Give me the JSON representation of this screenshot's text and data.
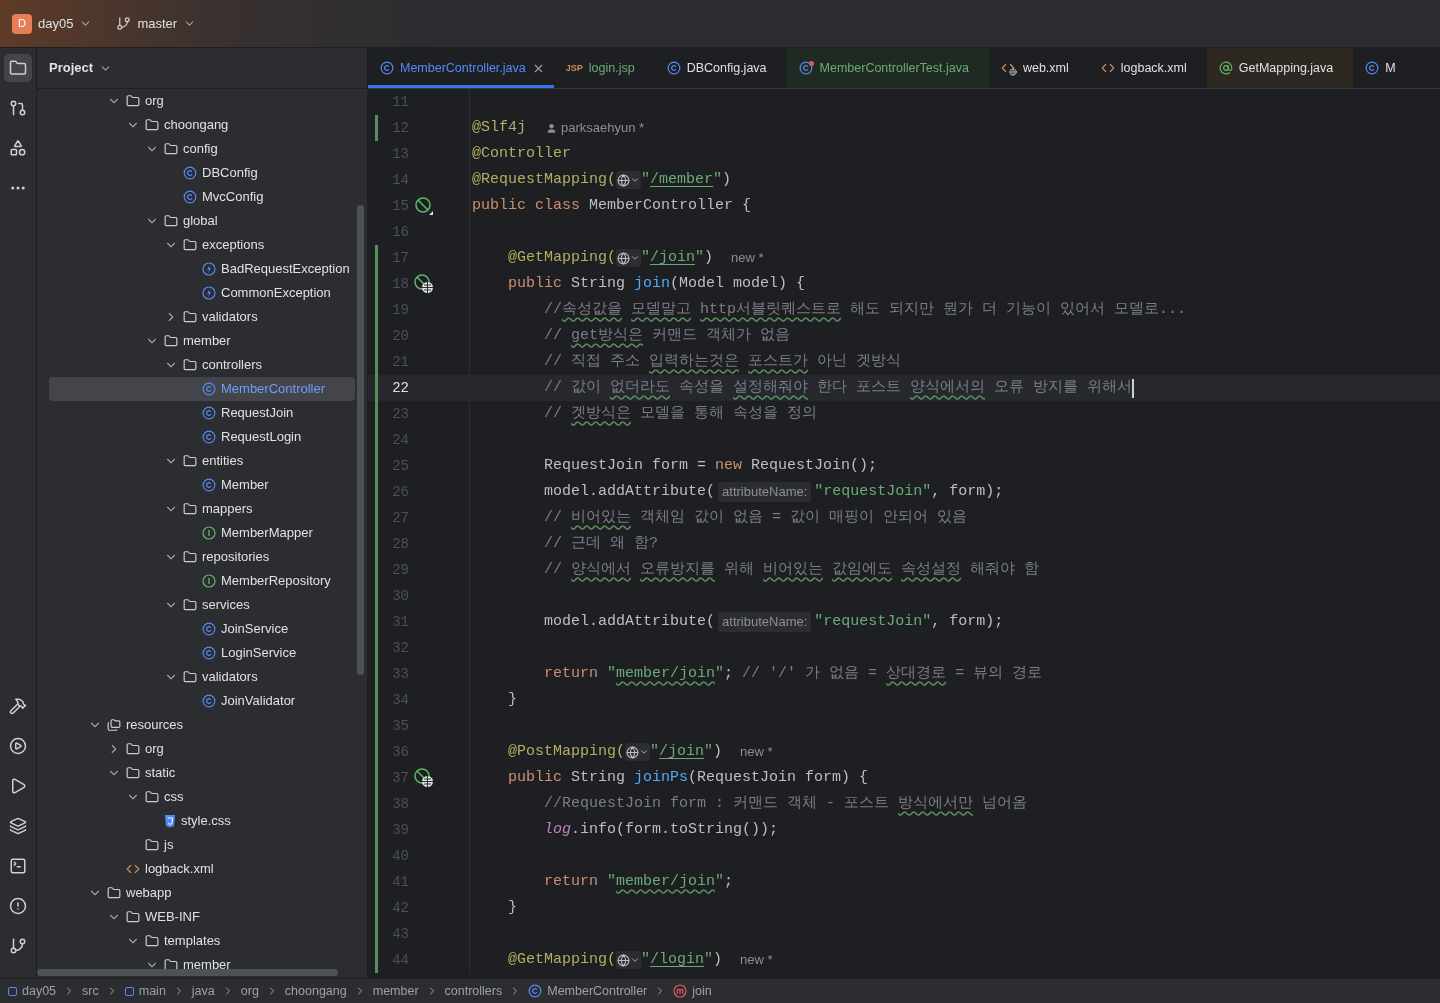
{
  "toolbar": {
    "project_badge": "D",
    "project": "day05",
    "branch": "master"
  },
  "project_panel": {
    "title": "Project",
    "tree": [
      {
        "kind": "offscreen",
        "children": [
          {
            "label": "org",
            "kind": "folder",
            "expanded": true,
            "selected": false,
            "children": [
              {
                "label": "choongang",
                "kind": "folder",
                "expanded": true,
                "selected": false,
                "children": [
                  {
                    "label": "config",
                    "kind": "folder",
                    "expanded": true,
                    "selected": false,
                    "children": [
                      {
                        "label": "DBConfig",
                        "kind": "class",
                        "selected": false
                      },
                      {
                        "label": "MvcConfig",
                        "kind": "class",
                        "selected": false
                      }
                    ]
                  },
                  {
                    "label": "global",
                    "kind": "folder",
                    "expanded": true,
                    "selected": false,
                    "children": [
                      {
                        "label": "exceptions",
                        "kind": "folder",
                        "expanded": true,
                        "selected": false,
                        "children": [
                          {
                            "label": "BadRequestException",
                            "kind": "exception",
                            "selected": false
                          },
                          {
                            "label": "CommonException",
                            "kind": "exception",
                            "selected": false
                          }
                        ]
                      },
                      {
                        "label": "validators",
                        "kind": "folder",
                        "expanded": false,
                        "selected": false
                      }
                    ]
                  },
                  {
                    "label": "member",
                    "kind": "folder",
                    "expanded": true,
                    "selected": false,
                    "children": [
                      {
                        "label": "controllers",
                        "kind": "folder",
                        "expanded": true,
                        "selected": false,
                        "children": [
                          {
                            "label": "MemberController",
                            "kind": "class",
                            "selected": true
                          },
                          {
                            "label": "RequestJoin",
                            "kind": "class",
                            "selected": false
                          },
                          {
                            "label": "RequestLogin",
                            "kind": "class",
                            "selected": false
                          }
                        ]
                      },
                      {
                        "label": "entities",
                        "kind": "folder",
                        "expanded": true,
                        "selected": false,
                        "children": [
                          {
                            "label": "Member",
                            "kind": "class",
                            "selected": false
                          }
                        ]
                      },
                      {
                        "label": "mappers",
                        "kind": "folder",
                        "expanded": true,
                        "selected": false,
                        "children": [
                          {
                            "label": "MemberMapper",
                            "kind": "interface",
                            "selected": false
                          }
                        ]
                      },
                      {
                        "label": "repositories",
                        "kind": "folder",
                        "expanded": true,
                        "selected": false,
                        "children": [
                          {
                            "label": "MemberRepository",
                            "kind": "interface",
                            "selected": false
                          }
                        ]
                      },
                      {
                        "label": "services",
                        "kind": "folder",
                        "expanded": true,
                        "selected": false,
                        "children": [
                          {
                            "label": "JoinService",
                            "kind": "class",
                            "selected": false
                          },
                          {
                            "label": "LoginService",
                            "kind": "class",
                            "selected": false
                          }
                        ]
                      },
                      {
                        "label": "validators",
                        "kind": "folder",
                        "expanded": true,
                        "selected": false,
                        "children": [
                          {
                            "label": "JoinValidator",
                            "kind": "class",
                            "selected": false
                          }
                        ]
                      }
                    ]
                  }
                ]
              }
            ]
          }
        ]
      },
      {
        "label": "resources",
        "kind": "resources",
        "expanded": true,
        "selected": false,
        "children": [
          {
            "label": "org",
            "kind": "folder",
            "expanded": false,
            "selected": false
          },
          {
            "label": "static",
            "kind": "folder",
            "expanded": true,
            "selected": false,
            "children": [
              {
                "label": "css",
                "kind": "folder",
                "expanded": true,
                "selected": false,
                "children": [
                  {
                    "label": "style.css",
                    "kind": "css",
                    "selected": false
                  }
                ]
              },
              {
                "label": "js",
                "kind": "folder",
                "selected": false
              }
            ]
          },
          {
            "label": "logback.xml",
            "kind": "xml",
            "selected": false
          }
        ]
      },
      {
        "label": "webapp",
        "kind": "folder",
        "expanded": true,
        "selected": false,
        "children": [
          {
            "label": "WEB-INF",
            "kind": "folder",
            "expanded": true,
            "selected": false,
            "children": [
              {
                "label": "templates",
                "kind": "folder",
                "expanded": true,
                "selected": false,
                "children": [
                  {
                    "label": "member",
                    "kind": "folder",
                    "expanded": true,
                    "selected": false
                  }
                ]
              }
            ]
          }
        ]
      }
    ]
  },
  "editor_tabs": [
    {
      "label": "MemberController.java",
      "kind": "class",
      "color": "#548af7",
      "selected": true,
      "closable": true,
      "test_scope": false,
      "library_scope": false
    },
    {
      "label": "login.jsp",
      "kind": "jsp",
      "icon_text": "JSP",
      "color": "#6aab73",
      "selected": false,
      "test_scope": false,
      "library_scope": false
    },
    {
      "label": "DBConfig.java",
      "kind": "class",
      "color": "#dfe1e5",
      "selected": false,
      "test_scope": false,
      "library_scope": false
    },
    {
      "label": "MemberControllerTest.java",
      "kind": "test",
      "color": "#6aab73",
      "selected": false,
      "test_scope": true,
      "library_scope": false
    },
    {
      "label": "web.xml",
      "kind": "webxml",
      "color": "#dfe1e5",
      "selected": false,
      "test_scope": false,
      "library_scope": false
    },
    {
      "label": "logback.xml",
      "kind": "xml",
      "color": "#dfe1e5",
      "selected": false,
      "test_scope": false,
      "library_scope": false
    },
    {
      "label": "GetMapping.java",
      "kind": "annotation",
      "color": "#dfe1e5",
      "selected": false,
      "test_scope": false,
      "library_scope": true
    },
    {
      "label": "M",
      "kind": "class",
      "color": "#dfe1e5",
      "selected": false,
      "test_scope": false,
      "library_scope": false
    }
  ],
  "editor": {
    "lines": [
      {
        "number": "11",
        "changed": false,
        "current": false
      },
      {
        "number": "12",
        "changed": true,
        "current": false,
        "tokens": [
          {
            "t": "@Slf4j",
            "kind": "ann"
          },
          {
            "t": "parksaehyun *",
            "kind": "author"
          }
        ]
      },
      {
        "number": "13",
        "changed": false,
        "current": false,
        "tokens": [
          {
            "t": "@Controller",
            "kind": "ann"
          }
        ]
      },
      {
        "number": "14",
        "changed": false,
        "current": false,
        "tokens": [
          {
            "t": "@RequestMapping(",
            "kind": "ann"
          },
          {
            "kind": "globe"
          },
          {
            "t": "\"",
            "kind": "str"
          },
          {
            "t": "/member",
            "kind": "url"
          },
          {
            "t": "\"",
            "kind": "str"
          },
          {
            "t": ")",
            "kind": "plain"
          }
        ]
      },
      {
        "number": "15",
        "changed": false,
        "current": false,
        "kind": "bean",
        "tokens": [
          {
            "t": "public class ",
            "kind": "kw"
          },
          {
            "t": "MemberController {",
            "kind": "plain"
          }
        ]
      },
      {
        "number": "16",
        "changed": false,
        "current": false
      },
      {
        "number": "17",
        "changed": true,
        "current": false,
        "tokens": [
          {
            "t": "    @GetMapping(",
            "kind": "ann"
          },
          {
            "kind": "globe"
          },
          {
            "t": "\"",
            "kind": "str"
          },
          {
            "t": "/join",
            "kind": "url"
          },
          {
            "t": "\"",
            "kind": "str"
          },
          {
            "t": ")",
            "kind": "plain"
          },
          {
            "t": "new *",
            "kind": "note"
          }
        ]
      },
      {
        "number": "18",
        "changed": true,
        "current": false,
        "kind": "endpoint",
        "tokens": [
          {
            "t": "    public ",
            "kind": "kw"
          },
          {
            "t": "String ",
            "kind": "plain"
          },
          {
            "t": "join",
            "kind": "fn"
          },
          {
            "t": "(Model model) {",
            "kind": "plain"
          }
        ]
      },
      {
        "number": "19",
        "changed": true,
        "current": false,
        "tokens": [
          {
            "t": "        //",
            "kind": "cmt"
          },
          {
            "t": "속성값을 ",
            "kind": "typo"
          },
          {
            "t": "모델말고 ",
            "kind": "typo"
          },
          {
            "t": "http서블릿퀘스트로",
            "kind": "typo"
          },
          {
            "t": " 해도 되지만 뭔가 더 기능이 있어서 모델로...",
            "kind": "cmt"
          }
        ]
      },
      {
        "number": "20",
        "changed": true,
        "current": false,
        "tokens": [
          {
            "t": "        // ",
            "kind": "cmt"
          },
          {
            "t": "get방식은",
            "kind": "typo"
          },
          {
            "t": " 커맨드 객체가 없음",
            "kind": "cmt"
          }
        ]
      },
      {
        "number": "21",
        "changed": true,
        "current": false,
        "tokens": [
          {
            "t": "        // 직접 주소 ",
            "kind": "cmt"
          },
          {
            "t": "입력하는것은 ",
            "kind": "typo"
          },
          {
            "t": "포스트가",
            "kind": "typo"
          },
          {
            "t": " 아닌 겟방식",
            "kind": "cmt"
          }
        ]
      },
      {
        "number": "22",
        "changed": true,
        "current": true,
        "tokens": [
          {
            "t": "        // 값이 ",
            "kind": "cmt"
          },
          {
            "t": "없더라도",
            "kind": "typo"
          },
          {
            "t": " 속성을 ",
            "kind": "cmt"
          },
          {
            "t": "설정해줘야",
            "kind": "typo"
          },
          {
            "t": " 한다 포스트 ",
            "kind": "cmt"
          },
          {
            "t": "양식에서의",
            "kind": "typo"
          },
          {
            "t": " 오류 방지를 위해서",
            "kind": "cmt"
          }
        ]
      },
      {
        "number": "23",
        "changed": true,
        "current": false,
        "tokens": [
          {
            "t": "        // ",
            "kind": "cmt"
          },
          {
            "t": "겟방식은",
            "kind": "typo"
          },
          {
            "t": " 모델을 통해 속성을 정의",
            "kind": "cmt"
          }
        ]
      },
      {
        "number": "24",
        "changed": true,
        "current": false
      },
      {
        "number": "25",
        "changed": true,
        "current": false,
        "tokens": [
          {
            "t": "        RequestJoin form = ",
            "kind": "plain"
          },
          {
            "t": "new ",
            "kind": "kw"
          },
          {
            "t": "RequestJoin();",
            "kind": "plain"
          }
        ]
      },
      {
        "number": "26",
        "changed": true,
        "current": false,
        "tokens": [
          {
            "t": "        model.addAttribute(",
            "kind": "plain"
          },
          {
            "t": "attributeName:",
            "kind": "hint"
          },
          {
            "t": "\"requestJoin\"",
            "kind": "str"
          },
          {
            "t": ", form);",
            "kind": "plain"
          }
        ]
      },
      {
        "number": "27",
        "changed": true,
        "current": false,
        "tokens": [
          {
            "t": "        // ",
            "kind": "cmt"
          },
          {
            "t": "비어있는",
            "kind": "typo"
          },
          {
            "t": " 객체임 값이 없음 = 값이 매핑이 안되어 있음",
            "kind": "cmt"
          }
        ]
      },
      {
        "number": "28",
        "changed": true,
        "current": false,
        "tokens": [
          {
            "t": "        // 근데 왜 함?",
            "kind": "cmt"
          }
        ]
      },
      {
        "number": "29",
        "changed": true,
        "current": false,
        "tokens": [
          {
            "t": "        // ",
            "kind": "cmt"
          },
          {
            "t": "양식에서 ",
            "kind": "typo"
          },
          {
            "t": "오류방지를",
            "kind": "typo"
          },
          {
            "t": " 위해 ",
            "kind": "cmt"
          },
          {
            "t": "비어있는 ",
            "kind": "typo"
          },
          {
            "t": "값임에도 ",
            "kind": "typo"
          },
          {
            "t": "속성설정",
            "kind": "typo"
          },
          {
            "t": " 해줘야 함",
            "kind": "cmt"
          }
        ]
      },
      {
        "number": "30",
        "changed": true,
        "current": false
      },
      {
        "number": "31",
        "changed": true,
        "current": false,
        "tokens": [
          {
            "t": "        model.addAttribute(",
            "kind": "plain"
          },
          {
            "t": "attributeName:",
            "kind": "hint"
          },
          {
            "t": "\"requestJoin\"",
            "kind": "str"
          },
          {
            "t": ", form);",
            "kind": "plain"
          }
        ]
      },
      {
        "number": "32",
        "changed": true,
        "current": false
      },
      {
        "number": "33",
        "changed": true,
        "current": false,
        "tokens": [
          {
            "t": "        return ",
            "kind": "kw"
          },
          {
            "t": "\"",
            "kind": "str"
          },
          {
            "t": "member/join",
            "kind": "strtypo"
          },
          {
            "t": "\"",
            "kind": "str"
          },
          {
            "t": ";",
            "kind": "plain"
          },
          {
            "t": " // '/' 가 없음 = ",
            "kind": "cmt"
          },
          {
            "t": "상대경로",
            "kind": "typo"
          },
          {
            "t": " = 뷰의 경로",
            "kind": "cmt"
          }
        ]
      },
      {
        "number": "34",
        "changed": true,
        "current": false,
        "tokens": [
          {
            "t": "    }",
            "kind": "plain"
          }
        ]
      },
      {
        "number": "35",
        "changed": true,
        "current": false
      },
      {
        "number": "36",
        "changed": true,
        "current": false,
        "tokens": [
          {
            "t": "    @PostMapping(",
            "kind": "ann"
          },
          {
            "kind": "globe"
          },
          {
            "t": "\"",
            "kind": "str"
          },
          {
            "t": "/join",
            "kind": "url"
          },
          {
            "t": "\"",
            "kind": "str"
          },
          {
            "t": ")",
            "kind": "plain"
          },
          {
            "t": "new *",
            "kind": "note"
          }
        ]
      },
      {
        "number": "37",
        "changed": true,
        "current": false,
        "kind": "endpoint",
        "tokens": [
          {
            "t": "    public ",
            "kind": "kw"
          },
          {
            "t": "String ",
            "kind": "plain"
          },
          {
            "t": "joinPs",
            "kind": "fn"
          },
          {
            "t": "(RequestJoin form) {",
            "kind": "plain"
          }
        ]
      },
      {
        "number": "38",
        "changed": true,
        "current": false,
        "tokens": [
          {
            "t": "        //RequestJoin form : 커맨드 객체 - 포스트 ",
            "kind": "cmt"
          },
          {
            "t": "방식에서만",
            "kind": "typo"
          },
          {
            "t": " 넘어옴",
            "kind": "cmt"
          }
        ]
      },
      {
        "number": "39",
        "changed": true,
        "current": false,
        "tokens": [
          {
            "t": "        log",
            "kind": "field"
          },
          {
            "t": ".info(form.toString());",
            "kind": "plain"
          }
        ]
      },
      {
        "number": "40",
        "changed": true,
        "current": false
      },
      {
        "number": "41",
        "changed": true,
        "current": false,
        "tokens": [
          {
            "t": "        return ",
            "kind": "kw"
          },
          {
            "t": "\"",
            "kind": "str"
          },
          {
            "t": "member/join",
            "kind": "strtypo"
          },
          {
            "t": "\"",
            "kind": "str"
          },
          {
            "t": ";",
            "kind": "plain"
          }
        ]
      },
      {
        "number": "42",
        "changed": true,
        "current": false,
        "tokens": [
          {
            "t": "    }",
            "kind": "plain"
          }
        ]
      },
      {
        "number": "43",
        "changed": true,
        "current": false
      },
      {
        "number": "44",
        "changed": true,
        "current": false,
        "tokens": [
          {
            "t": "    @GetMapping(",
            "kind": "ann"
          },
          {
            "kind": "globe"
          },
          {
            "t": "\"",
            "kind": "str"
          },
          {
            "t": "/login",
            "kind": "url"
          },
          {
            "t": "\"",
            "kind": "str"
          },
          {
            "t": ")",
            "kind": "plain"
          },
          {
            "t": "new *",
            "kind": "note"
          }
        ]
      }
    ]
  },
  "breadcrumbs": [
    {
      "label": "day05",
      "kind": "module"
    },
    {
      "label": "src",
      "kind": "plain"
    },
    {
      "label": "main",
      "kind": "module"
    },
    {
      "label": "java",
      "kind": "plain"
    },
    {
      "label": "org",
      "kind": "plain"
    },
    {
      "label": "choongang",
      "kind": "plain"
    },
    {
      "label": "member",
      "kind": "plain"
    },
    {
      "label": "controllers",
      "kind": "plain"
    },
    {
      "label": "MemberController",
      "kind": "class"
    },
    {
      "label": "join",
      "kind": "method"
    }
  ]
}
